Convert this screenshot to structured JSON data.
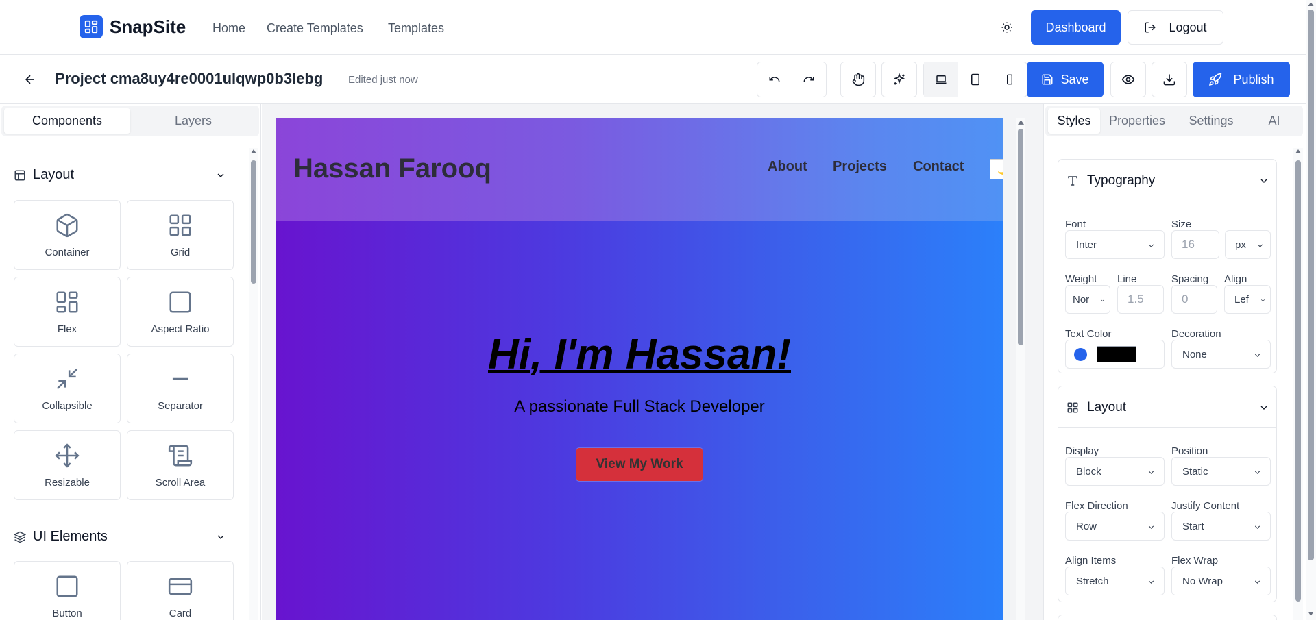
{
  "app": {
    "name": "SnapSite",
    "nav": [
      "Home",
      "Create Templates",
      "Templates"
    ],
    "dashboard_label": "Dashboard",
    "logout_label": "Logout"
  },
  "toolbar": {
    "project_title": "Project cma8uy4re0001ulqwp0b3lebg",
    "edited": "Edited just now",
    "save_label": "Save",
    "publish_label": "Publish",
    "active_device": "desktop"
  },
  "left_panel": {
    "tabs": [
      "Components",
      "Layers"
    ],
    "active_tab": "Components",
    "layout_section": {
      "title": "Layout",
      "items": [
        {
          "label": "Container",
          "icon": "box-icon"
        },
        {
          "label": "Grid",
          "icon": "grid-icon"
        },
        {
          "label": "Flex",
          "icon": "flex-layout-icon"
        },
        {
          "label": "Aspect Ratio",
          "icon": "square-icon"
        },
        {
          "label": "Collapsible",
          "icon": "shrink-icon"
        },
        {
          "label": "Separator",
          "icon": "minus-icon"
        },
        {
          "label": "Resizable",
          "icon": "move-icon"
        },
        {
          "label": "Scroll Area",
          "icon": "scroll-icon"
        }
      ]
    },
    "ui_section": {
      "title": "UI Elements",
      "items": [
        {
          "label": "Button",
          "icon": "square-icon"
        },
        {
          "label": "Card",
          "icon": "card-icon"
        }
      ]
    }
  },
  "canvas": {
    "site_name": "Hassan Farooq",
    "nav": [
      "About",
      "Projects",
      "Contact"
    ],
    "theme_toggle": "🌙",
    "hero_title": "Hi, I'm Hassan!",
    "hero_subtitle": "A passionate Full Stack Developer",
    "hero_button": "View My Work"
  },
  "right_panel": {
    "tabs": [
      "Styles",
      "Properties",
      "Settings",
      "AI"
    ],
    "active_tab": "Styles",
    "typography": {
      "title": "Typography",
      "font_label": "Font",
      "font_value": "Inter",
      "size_label": "Size",
      "size_value": "16",
      "unit_value": "px",
      "weight_label": "Weight",
      "weight_value": "Nor",
      "line_label": "Line",
      "line_value": "1.5",
      "spacing_label": "Spacing",
      "spacing_value": "0",
      "align_label": "Align",
      "align_value": "Lef",
      "text_color_label": "Text Color",
      "text_color_value": "#000000",
      "decoration_label": "Decoration",
      "decoration_value": "None"
    },
    "layout": {
      "title": "Layout",
      "display_label": "Display",
      "display_value": "Block",
      "position_label": "Position",
      "position_value": "Static",
      "flex_direction_label": "Flex Direction",
      "flex_direction_value": "Row",
      "justify_label": "Justify Content",
      "justify_value": "Start",
      "align_items_label": "Align Items",
      "align_items_value": "Stretch",
      "flex_wrap_label": "Flex Wrap",
      "flex_wrap_value": "No Wrap"
    }
  },
  "colors": {
    "primary": "#2563eb",
    "hero_button": "#d5303b",
    "color_dot": "#2563eb"
  }
}
